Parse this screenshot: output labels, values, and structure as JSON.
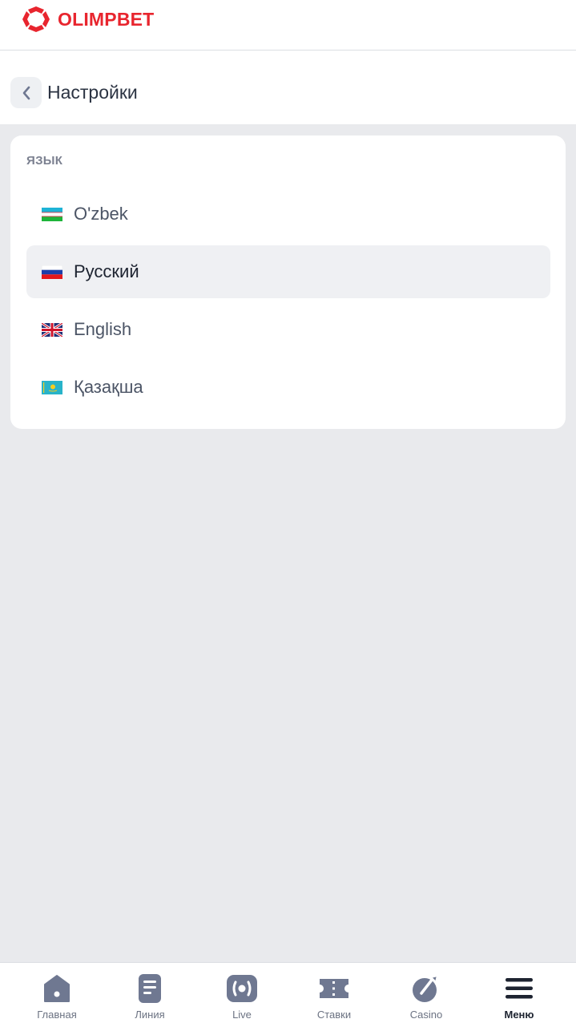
{
  "app": {
    "brand": "OLIMPBET",
    "brand_color": "#e8252e",
    "logo_icon": "olimpbet-logo-icon"
  },
  "header": {
    "back_icon": "chevron-left-icon",
    "title": "Настройки"
  },
  "language_section": {
    "label": "ЯЗЫК",
    "selected": "Русский",
    "items": [
      {
        "label": "O'zbek",
        "flag": "uzbekistan-flag-icon",
        "selected": false
      },
      {
        "label": "Русский",
        "flag": "russia-flag-icon",
        "selected": true
      },
      {
        "label": "English",
        "flag": "uk-flag-icon",
        "selected": false
      },
      {
        "label": "Қазақша",
        "flag": "kazakhstan-flag-icon",
        "selected": false
      }
    ]
  },
  "tabbar": {
    "active": "Меню",
    "items": [
      {
        "label": "Главная",
        "icon": "home-icon"
      },
      {
        "label": "Линия",
        "icon": "line-list-icon"
      },
      {
        "label": "Live",
        "icon": "live-icon"
      },
      {
        "label": "Ставки",
        "icon": "ticket-icon"
      },
      {
        "label": "Casino",
        "icon": "casino-icon"
      },
      {
        "label": "Меню",
        "icon": "menu-icon"
      }
    ]
  },
  "colors": {
    "background": "#e9eaed",
    "surface": "#ffffff",
    "selected_row": "#eff0f3",
    "icon": "#6f7891"
  }
}
